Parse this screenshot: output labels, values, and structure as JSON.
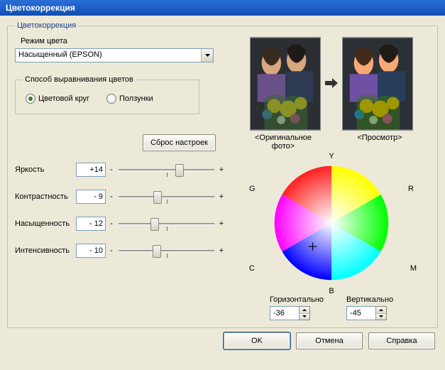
{
  "window": {
    "title": "Цветокоррекция"
  },
  "group": {
    "legend": "Цветокоррекция"
  },
  "mode": {
    "label": "Режим цвета",
    "selected": "Насыщенный (EPSON)"
  },
  "align": {
    "legend": "Способ выравнивания цветов",
    "wheel": "Цветовой круг",
    "sliders": "Ползунки",
    "selected": "wheel"
  },
  "reset": {
    "label": "Сброс настроек"
  },
  "sliders": {
    "brightness": {
      "label": "Яркость",
      "value": "+14"
    },
    "contrast": {
      "label": "Контрастность",
      "value": "- 9"
    },
    "saturation": {
      "label": "Насыщенность",
      "value": "- 12"
    },
    "intensity": {
      "label": "Интенсивность",
      "value": "- 10"
    }
  },
  "preview": {
    "original": "<Оригинальное фото>",
    "preview": "<Просмотр>"
  },
  "wheel": {
    "Y": "Y",
    "G": "G",
    "R": "R",
    "C": "C",
    "M": "M",
    "B": "B"
  },
  "hv": {
    "h_label": "Горизонтально",
    "v_label": "Вертикально",
    "h_value": "-36",
    "v_value": "-45"
  },
  "buttons": {
    "ok": "OK",
    "cancel": "Отмена",
    "help": "Справка"
  },
  "slider_positions": {
    "brightness": 64,
    "contrast": 41,
    "saturation": 38,
    "intensity": 40
  }
}
